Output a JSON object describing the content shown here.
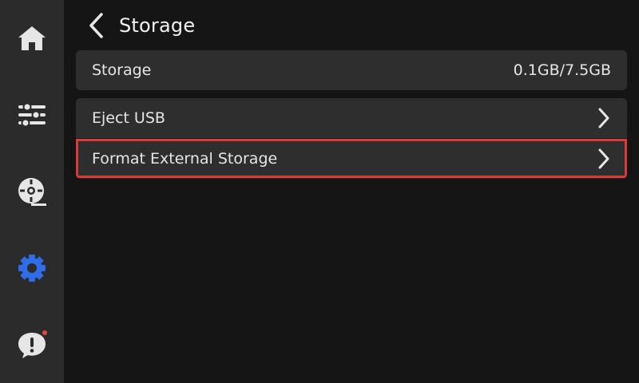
{
  "colors": {
    "sidebar_bg": "#2b2b2b",
    "background": "#151515",
    "card_bg": "#2e2e2e",
    "icon_default": "#e6e6e6",
    "icon_active": "#2f6de8",
    "notification_dot": "#e04848",
    "highlight_border": "#d93a3a"
  },
  "sidebar": {
    "items": [
      {
        "name": "home",
        "icon": "home-icon",
        "active": false
      },
      {
        "name": "controls",
        "icon": "sliders-icon",
        "active": false
      },
      {
        "name": "filament",
        "icon": "spool-icon",
        "active": false
      },
      {
        "name": "settings",
        "icon": "gear-icon",
        "active": true
      },
      {
        "name": "notifications",
        "icon": "alert-icon",
        "active": false,
        "has_notification": true
      }
    ]
  },
  "header": {
    "title": "Storage",
    "back_icon": "chevron-left-icon"
  },
  "storage_info": {
    "label": "Storage",
    "value": "0.1GB/7.5GB"
  },
  "options": [
    {
      "label": "Eject USB",
      "icon": "chevron-right-icon",
      "highlighted": false
    },
    {
      "label": "Format External Storage",
      "icon": "chevron-right-icon",
      "highlighted": true
    }
  ]
}
